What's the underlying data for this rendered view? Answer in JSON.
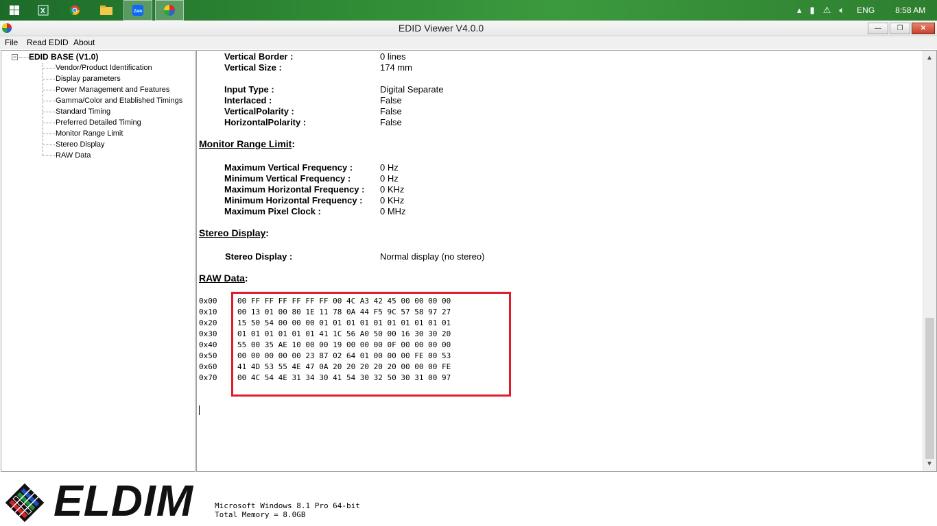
{
  "window": {
    "title": "EDID Viewer V4.0.0",
    "min_glyph": "—",
    "max_glyph": "❐",
    "close_glyph": "✕"
  },
  "taskbar": {
    "language": "ENG",
    "clock": "8:58 AM"
  },
  "menu": [
    "File",
    "Read EDID",
    "About"
  ],
  "tree": {
    "root": "EDID BASE (V1.0)",
    "expander": "−",
    "items": [
      "Vendor/Product Identification",
      "Display parameters",
      "Power Management and Features",
      "Gamma/Color and Etablished Timings",
      "Standard Timing",
      "Preferred Detailed Timing",
      "Monitor Range Limit",
      "Stereo Display",
      "RAW Data"
    ]
  },
  "content": {
    "display_params": [
      {
        "label": "Vertical Border :",
        "value": "0 lines"
      },
      {
        "label": "Vertical Size :",
        "value": "174 mm"
      },
      {
        "label": "Input Type :",
        "value": "Digital Separate"
      },
      {
        "label": "Interlaced :",
        "value": "False"
      },
      {
        "label": "VerticalPolarity :",
        "value": "False"
      },
      {
        "label": "HorizontalPolarity :",
        "value": "False"
      }
    ],
    "monitor_range_title": "Monitor Range Limit",
    "monitor_range": [
      {
        "label": "Maximum Vertical Frequency :",
        "value": "0 Hz"
      },
      {
        "label": "Minimum Vertical Frequency :",
        "value": "0 Hz"
      },
      {
        "label": "Maximum Horizontal Frequency :",
        "value": "0 KHz"
      },
      {
        "label": "Minimum Horizontal Frequency :",
        "value": "0 KHz"
      },
      {
        "label": "Maximum Pixel Clock :",
        "value": "0 MHz"
      }
    ],
    "stereo_title": "Stereo Display",
    "stereo": {
      "label": "Stereo Display :",
      "value": "Normal display (no stereo)"
    },
    "raw_title": "RAW Data",
    "colon": ":",
    "raw": [
      {
        "addr": "0x00",
        "bytes": "00 FF FF FF FF FF FF 00 4C A3 42 45 00 00 00 00"
      },
      {
        "addr": "0x10",
        "bytes": "00 13 01 00 80 1E 11 78 0A 44 F5 9C 57 58 97 27"
      },
      {
        "addr": "0x20",
        "bytes": "15 50 54 00 00 00 01 01 01 01 01 01 01 01 01 01"
      },
      {
        "addr": "0x30",
        "bytes": "01 01 01 01 01 01 41 1C 56 A0 50 00 16 30 30 20"
      },
      {
        "addr": "0x40",
        "bytes": "55 00 35 AE 10 00 00 19 00 00 00 0F 00 00 00 00"
      },
      {
        "addr": "0x50",
        "bytes": "00 00 00 00 00 23 87 02 64 01 00 00 00 FE 00 53"
      },
      {
        "addr": "0x60",
        "bytes": "41 4D 53 55 4E 47 0A 20 20 20 20 20 00 00 00 FE"
      },
      {
        "addr": "0x70",
        "bytes": "00 4C 54 4E 31 34 30 41 54 30 32 50 30 31 00 97"
      }
    ],
    "highlight_color": "#e11b2a"
  },
  "footer": {
    "logo": "ELDIM",
    "os": "Microsoft Windows 8.1 Pro 64-bit",
    "memory": "Total Memory = 8.0GB"
  }
}
